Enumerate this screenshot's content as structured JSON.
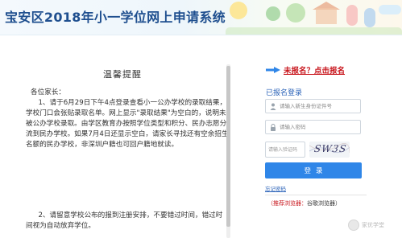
{
  "header": {
    "title": "宝安区2018年小一学位网上申请系统"
  },
  "notice": {
    "title": "温馨提醒",
    "salutation": "各位家长：",
    "paragraph1": "1、请于6月29日下午4点登录查看小一公办学校的录取结果，学校门口会张贴录取名单。网上显示\"录取结果\"为空白的，说明未被公办学校录取。由学区教育办按照学位类型和积分、民办志愿分流到民办学校。如果7月4日还显示空白，请家长寻找还有空余招生名额的民办学校，非深圳户籍也可回户籍地就读。",
    "paragraph2": "2、请留意学校公布的报到注册安排，不要错过时间，错过时间视为自动放弃学位。"
  },
  "login": {
    "register_link": "未报名？点击报名",
    "registered_label": "已报名登录",
    "id_placeholder": "请输入新生身份证件号",
    "password_placeholder": "请输入密码",
    "captcha_placeholder": "请输入验证码",
    "captcha_text": "SW3S",
    "login_button": "登录",
    "forgot_link": "忘记密码",
    "browser_tip_label": "（推荐浏览器：",
    "browser_tip_value": "谷歌浏览器）"
  },
  "watermark": {
    "text": "家优学堂"
  },
  "colors": {
    "title_blue": "#1f4f8f",
    "link_red": "#c8161d",
    "accent_blue": "#2f86e8"
  },
  "icons": {
    "arrow": "arrow-right-icon",
    "user": "user-icon",
    "lock": "lock-icon"
  }
}
